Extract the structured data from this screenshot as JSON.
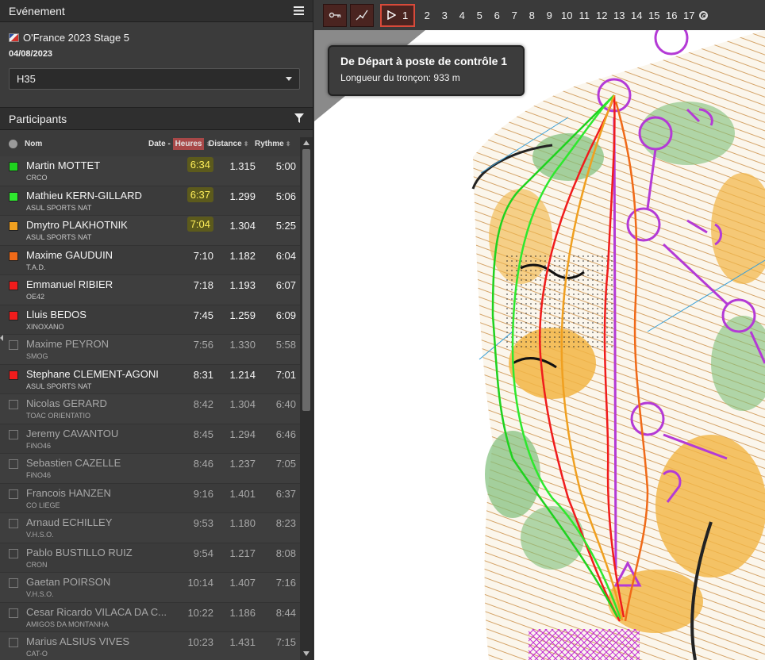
{
  "event": {
    "section_title": "Evénement",
    "title": "O'France 2023 Stage 5",
    "date": "04/08/2023",
    "category": "H35"
  },
  "participants": {
    "section_title": "Participants",
    "columns": {
      "nom": "Nom",
      "date_prefix": "Date - ",
      "heures": "Heures",
      "distance": "Distance",
      "rythme": "Rythme"
    },
    "rows": [
      {
        "name": "Martin MOTTET",
        "club": "CRCO",
        "time": "6:34",
        "dist": "1.315",
        "pace": "5:00",
        "color": "#1fd21f",
        "highlight": true,
        "checked": true
      },
      {
        "name": "Mathieu KERN-GILLARD",
        "club": "ASUL SPORTS NAT",
        "time": "6:37",
        "dist": "1.299",
        "pace": "5:06",
        "color": "#2ee82e",
        "highlight": true,
        "checked": true
      },
      {
        "name": "Dmytro PLAKHOTNIK",
        "club": "ASUL SPORTS NAT",
        "time": "7:04",
        "dist": "1.304",
        "pace": "5:25",
        "color": "#f0a020",
        "highlight": true,
        "checked": true
      },
      {
        "name": "Maxime GAUDUIN",
        "club": "T.A.D.",
        "time": "7:10",
        "dist": "1.182",
        "pace": "6:04",
        "color": "#f06a18",
        "highlight": false,
        "checked": true
      },
      {
        "name": "Emmanuel RIBIER",
        "club": "OE42",
        "time": "7:18",
        "dist": "1.193",
        "pace": "6:07",
        "color": "#f01c1c",
        "highlight": false,
        "checked": true
      },
      {
        "name": "Lluis BEDOS",
        "club": "XINOXANO",
        "time": "7:45",
        "dist": "1.259",
        "pace": "6:09",
        "color": "#f01c1c",
        "highlight": false,
        "checked": true
      },
      {
        "name": "Maxime PEYRON",
        "club": "SMOG",
        "time": "7:56",
        "dist": "1.330",
        "pace": "5:58",
        "color": "",
        "highlight": false,
        "checked": false
      },
      {
        "name": "Stephane CLEMENT-AGONI",
        "club": "ASUL SPORTS NAT",
        "time": "8:31",
        "dist": "1.214",
        "pace": "7:01",
        "color": "#f01c1c",
        "highlight": false,
        "checked": true
      },
      {
        "name": "Nicolas GERARD",
        "club": "TOAC ORIENTATIO",
        "time": "8:42",
        "dist": "1.304",
        "pace": "6:40",
        "color": "",
        "highlight": false,
        "checked": false
      },
      {
        "name": "Jeremy CAVANTOU",
        "club": "FiNO46",
        "time": "8:45",
        "dist": "1.294",
        "pace": "6:46",
        "color": "",
        "highlight": false,
        "checked": false
      },
      {
        "name": "Sebastien CAZELLE",
        "club": "FiNO46",
        "time": "8:46",
        "dist": "1.237",
        "pace": "7:05",
        "color": "",
        "highlight": false,
        "checked": false
      },
      {
        "name": "Francois HANZEN",
        "club": "CO LIEGE",
        "time": "9:16",
        "dist": "1.401",
        "pace": "6:37",
        "color": "",
        "highlight": false,
        "checked": false
      },
      {
        "name": "Arnaud ECHILLEY",
        "club": "V.H.S.O.",
        "time": "9:53",
        "dist": "1.180",
        "pace": "8:23",
        "color": "",
        "highlight": false,
        "checked": false
      },
      {
        "name": "Pablo BUSTILLO RUIZ",
        "club": "CRON",
        "time": "9:54",
        "dist": "1.217",
        "pace": "8:08",
        "color": "",
        "highlight": false,
        "checked": false
      },
      {
        "name": "Gaetan POIRSON",
        "club": "V.H.S.O.",
        "time": "10:14",
        "dist": "1.407",
        "pace": "7:16",
        "color": "",
        "highlight": false,
        "checked": false
      },
      {
        "name": "Cesar Ricardo VILACA DA C...",
        "club": "AMIGOS DA MONTANHA",
        "time": "10:22",
        "dist": "1.186",
        "pace": "8:44",
        "color": "",
        "highlight": false,
        "checked": false
      },
      {
        "name": "Marius ALSIUS VIVES",
        "club": "CAT-O",
        "time": "10:23",
        "dist": "1.431",
        "pace": "7:15",
        "color": "",
        "highlight": false,
        "checked": false
      }
    ]
  },
  "toolbar": {
    "active_control": "1",
    "controls": [
      "2",
      "3",
      "4",
      "5",
      "6",
      "7",
      "8",
      "9",
      "10",
      "11",
      "12",
      "13",
      "14",
      "15",
      "16",
      "17"
    ]
  },
  "tooltip": {
    "title": "De Départ à poste de contrôle 1",
    "subtitle": "Longueur du tronçon: 933 m"
  }
}
